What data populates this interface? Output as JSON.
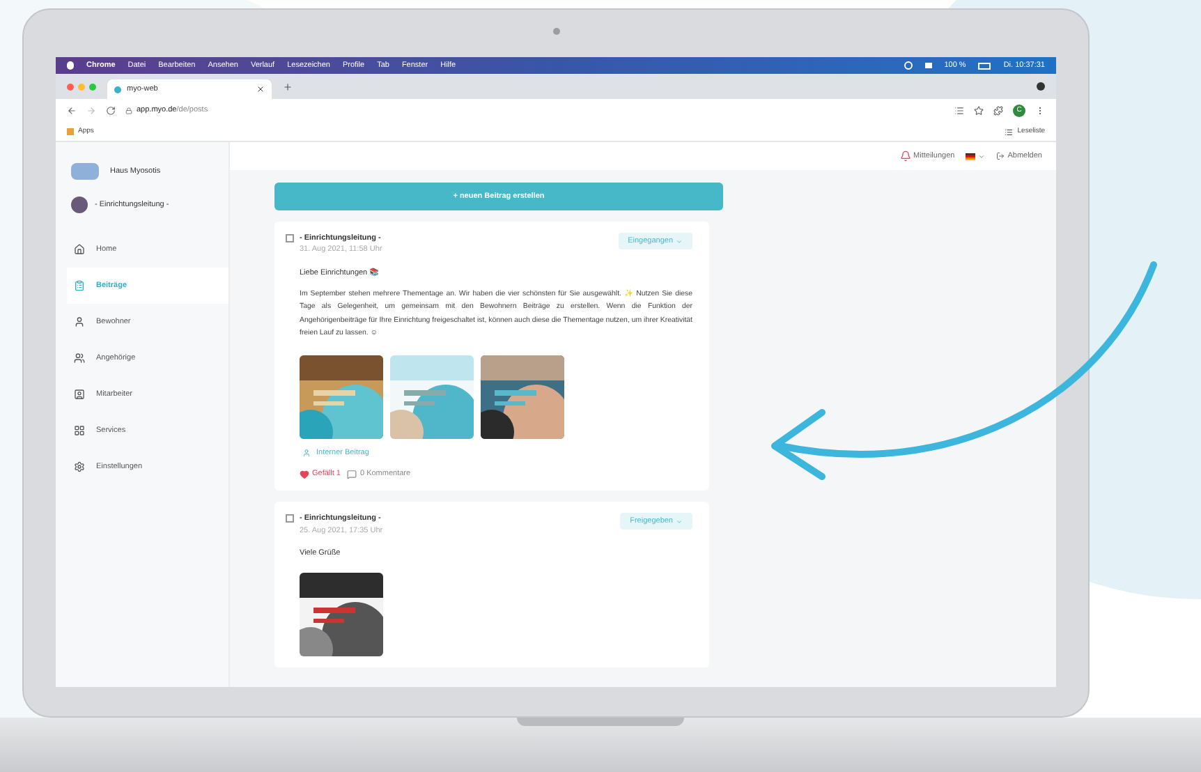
{
  "menu_bar": {
    "items": [
      "Chrome",
      "Datei",
      "Bearbeiten",
      "Ansehen",
      "Verlauf",
      "Lesezeichen",
      "Profile",
      "Tab",
      "Fenster",
      "Hilfe"
    ],
    "battery": "100 %",
    "clock": "Di. 10:37:31"
  },
  "browser": {
    "tab_title": "myo-web",
    "url_host": "app.myo.de",
    "url_path": "/de/posts",
    "bookmarks": "Apps",
    "reading_list": "Leseliste",
    "profile_initial": "C"
  },
  "sidebar": {
    "home_name": "Haus Myosotis",
    "role": "- Einrichtungsleitung -",
    "items": [
      {
        "label": "Home",
        "selected": false
      },
      {
        "label": "Beiträge",
        "selected": true
      },
      {
        "label": "Bewohner",
        "selected": false
      },
      {
        "label": "Angehörige",
        "selected": false
      },
      {
        "label": "Mitarbeiter",
        "selected": false
      },
      {
        "label": "Services",
        "selected": false
      },
      {
        "label": "Einstellungen",
        "selected": false
      }
    ]
  },
  "top_bar": {
    "notifications": "Mitteilungen",
    "logout": "Abmelden"
  },
  "new_post_button": "+ neuen Beitrag erstellen",
  "posts": [
    {
      "author": "- Einrichtungsleitung -",
      "date": "31. Aug 2021, 11:58 Uhr",
      "status": "Eingegangen",
      "checked": false,
      "greeting": "Liebe Einrichtungen 📚",
      "body": "Im September stehen mehrere Thementage an. Wir haben die vier schönsten für Sie ausgewählt. ✨ Nutzen Sie diese Tage als Gelegenheit, um gemeinsam mit den Bewohnern Beiträge zu erstellen. Wenn die Funktion der Angehörigenbeiträge für Ihre Einrichtung freigeschaltet ist, können auch diese die Thementage nutzen, um ihrer Kreativität freien Lauf zu lassen. ☺",
      "visibility": "Interner Beitrag",
      "likes": "Gefällt 1",
      "liked": true,
      "comments": "0 Kommentare"
    },
    {
      "author": "- Einrichtungsleitung -",
      "date": "25. Aug 2021, 17:35 Uhr",
      "status": "Freigegeben",
      "checked": false,
      "greeting": "Viele Grüße"
    }
  ]
}
